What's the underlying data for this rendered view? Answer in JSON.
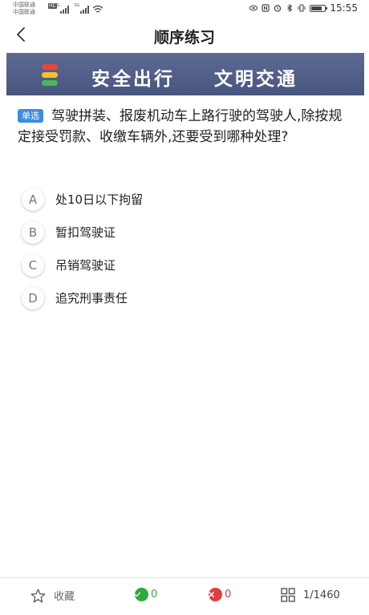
{
  "statusbar": {
    "carrier1": "中国联通",
    "carrier2": "中国联通",
    "hd": "HD",
    "net1": "4G",
    "net2": "3G",
    "time": "15:55"
  },
  "header": {
    "title": "顺序练习"
  },
  "banner": {
    "text_left": "安全出行",
    "text_right": "文明交通",
    "light_colors": [
      "#e8463c",
      "#f2c232",
      "#4cb84e"
    ]
  },
  "question": {
    "type": "单选",
    "text": "驾驶拼装、报废机动车上路行驶的驾驶人,除按规定接受罚款、收缴车辆外,还要受到哪种处理?"
  },
  "options": [
    {
      "letter": "A",
      "text": "处10日以下拘留"
    },
    {
      "letter": "B",
      "text": "暂扣驾驶证"
    },
    {
      "letter": "C",
      "text": "吊销驾驶证"
    },
    {
      "letter": "D",
      "text": "追究刑事责任"
    }
  ],
  "bottombar": {
    "favorite_label": "收藏",
    "correct_count": "0",
    "wrong_count": "0",
    "progress": "1/1460"
  },
  "colors": {
    "accent": "#3a8de0",
    "correct": "#2faa3c",
    "wrong": "#e23c3c",
    "banner": "#505d88"
  }
}
